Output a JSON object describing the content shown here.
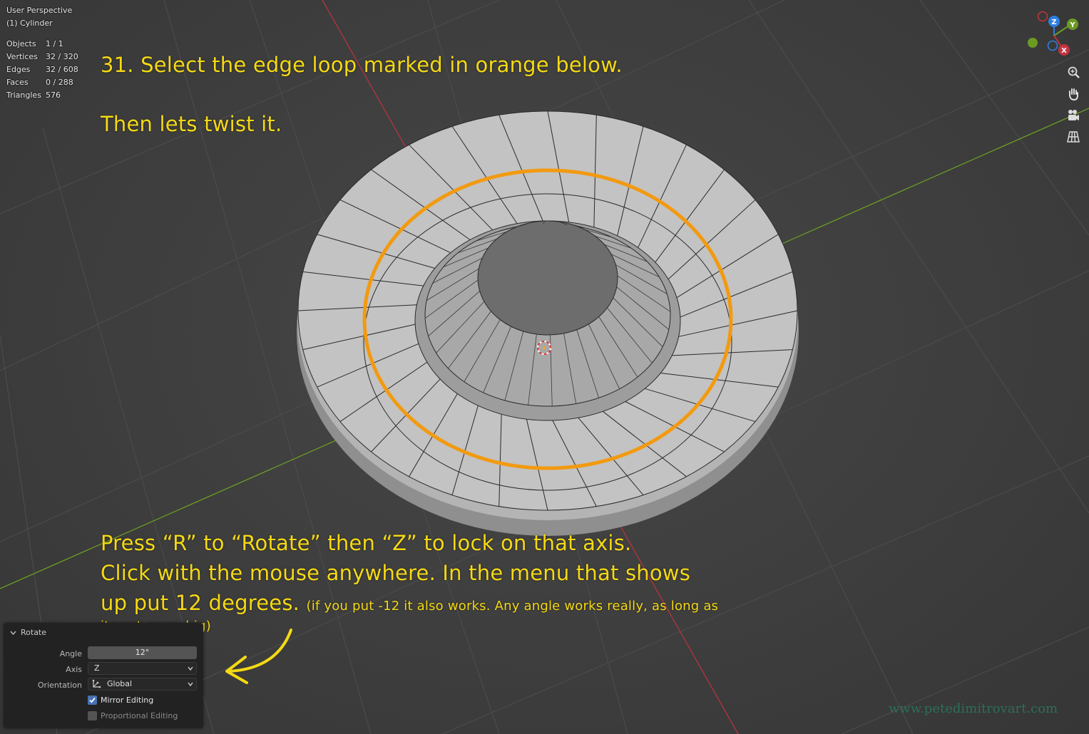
{
  "viewport": {
    "title": "User Perspective",
    "object_name": "(1) Cylinder",
    "stats": [
      {
        "label": "Objects",
        "value": "1 / 1"
      },
      {
        "label": "Vertices",
        "value": "32 / 320"
      },
      {
        "label": "Edges",
        "value": "32 / 608"
      },
      {
        "label": "Faces",
        "value": "0 / 288"
      },
      {
        "label": "Triangles",
        "value": "576"
      }
    ]
  },
  "annotations": {
    "step_line1": "31. Select the edge loop marked in orange below.",
    "step_line2": "Then lets twist it.",
    "press_line1": "Press “R” to “Rotate” then “Z” to lock on that axis.",
    "press_line2": "Click with the mouse anywhere. In the menu that shows",
    "press_line3": "up put 12 degrees.",
    "note_part1": "(if you put -12 it also works. Any angle works really, as long as",
    "note_part2": "its not crazy big)"
  },
  "gizmo": {
    "x": "X",
    "y": "Y",
    "z": "Z"
  },
  "nav_buttons": [
    "zoom-icon",
    "hand-pan-icon",
    "camera-icon",
    "grid-ortho-icon"
  ],
  "operator_panel": {
    "title": "Rotate",
    "angle_label": "Angle",
    "angle_value": "12°",
    "axis_label": "Axis",
    "axis_value": "Z",
    "orientation_label": "Orientation",
    "orientation_value": "Global",
    "mirror_label": "Mirror Editing",
    "mirror_checked": true,
    "proportional_label": "Proportional Editing",
    "proportional_checked": false
  },
  "watermark": "www.petedimitrovart.com",
  "colors": {
    "annotation": "#f5d915",
    "edge_loop": "#f29a10",
    "x_axis": "#b5343e",
    "y_axis": "#6b9a23",
    "gizmo_z": "#2f7fe0"
  }
}
